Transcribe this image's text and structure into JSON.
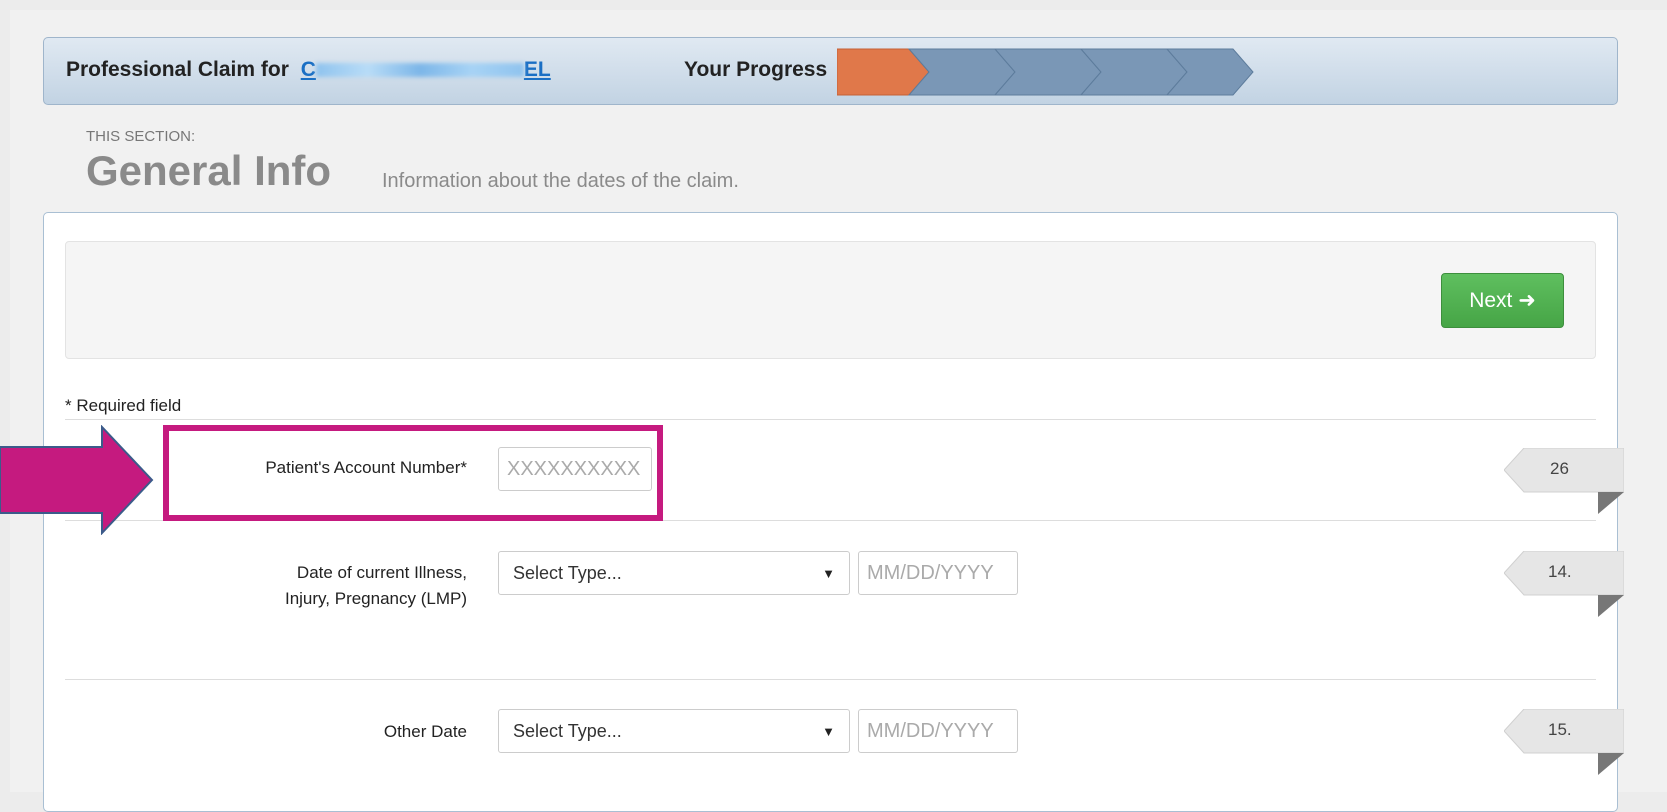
{
  "header": {
    "claim_prefix": "Professional Claim for",
    "patient_link_start": "C",
    "patient_link_end": "EL",
    "progress_label": "Your Progress",
    "progress": {
      "steps_total": 5,
      "current_step": 1,
      "active_color": "#e0784a",
      "inactive_color": "#7a97b6"
    }
  },
  "section": {
    "kicker": "THIS SECTION:",
    "title": "General Info",
    "description": "Information about the dates of the claim."
  },
  "actions": {
    "next_label": "Next ➜"
  },
  "form": {
    "required_note": "* Required field",
    "fields": [
      {
        "label": "Patient's Account Number*",
        "placeholder": "XXXXXXXXXX",
        "box": "26"
      },
      {
        "label_line1": "Date of current Illness,",
        "label_line2": "Injury, Pregnancy (LMP)",
        "select_value": "Select Type...",
        "date_placeholder": "MM/DD/YYYY",
        "box": "14."
      },
      {
        "label": "Other Date",
        "select_value": "Select Type...",
        "date_placeholder": "MM/DD/YYYY",
        "box": "15."
      }
    ]
  },
  "annotation": {
    "color": "#c51a7f"
  }
}
